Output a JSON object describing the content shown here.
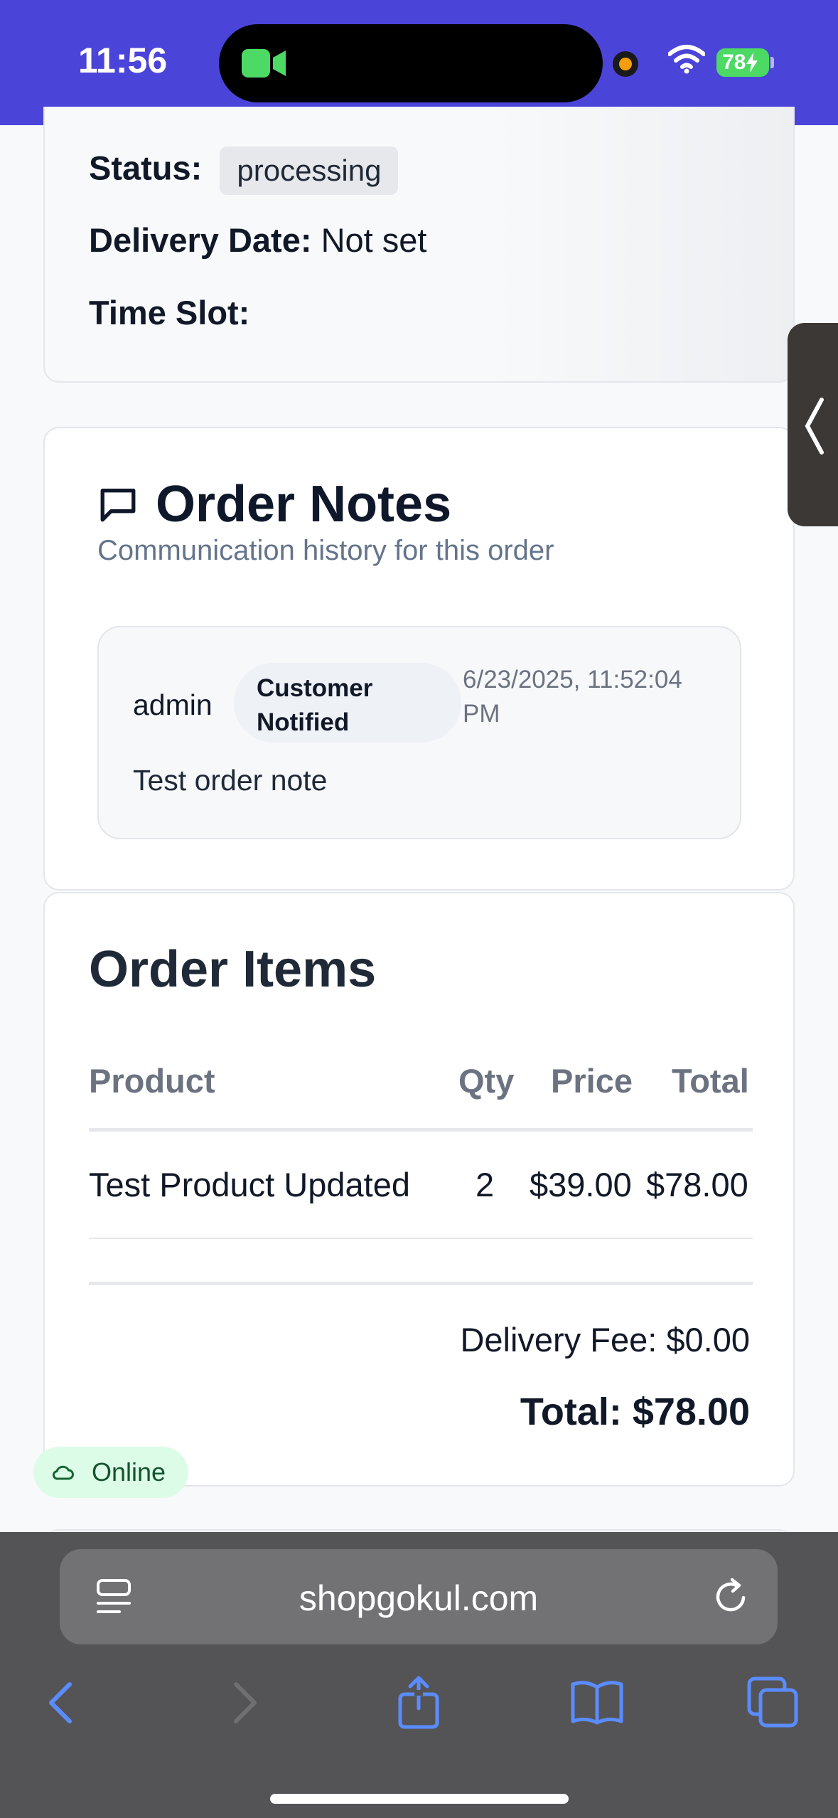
{
  "status_bar": {
    "time": "11:56",
    "battery": "78"
  },
  "order_info": {
    "status_label": "Status:",
    "status_value": "processing",
    "delivery_label": "Delivery Date:",
    "delivery_value": "Not set",
    "slot_label": "Time Slot:",
    "slot_value": ""
  },
  "notes": {
    "title": "Order Notes",
    "subtitle": "Communication history for this order",
    "items": [
      {
        "author": "admin",
        "badge_line1": "Customer",
        "badge_line2": "Notified",
        "time_line1": "6/23/2025, 11:52:04",
        "time_line2": "PM",
        "text": "Test order note"
      }
    ]
  },
  "items": {
    "title": "Order Items",
    "headers": [
      "Product",
      "Qty",
      "Price",
      "Total"
    ],
    "rows": [
      {
        "product": "Test Product Updated",
        "qty": "2",
        "price": "$39.00",
        "total": "$78.00"
      }
    ],
    "delivery_fee": "Delivery Fee: $0.00",
    "total": "Total: $78.00"
  },
  "connection": {
    "label": "Online"
  },
  "browser": {
    "url": "shopgokul.com"
  },
  "colors": {
    "accent": "#4b44d8",
    "online_bg": "#dcfce7",
    "browser_bg": "#545456",
    "toolbar_icon": "#5b8cff"
  }
}
